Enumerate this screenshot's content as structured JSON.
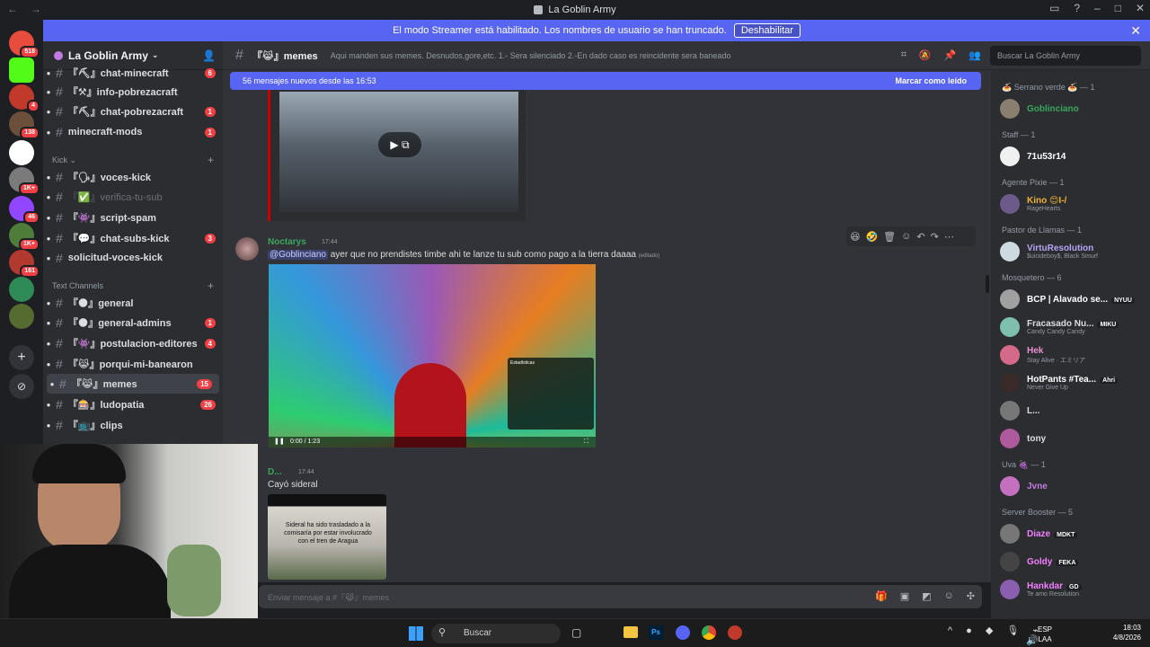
{
  "window": {
    "title": "La Goblin Army"
  },
  "banner": {
    "text": "El modo Streamer está habilitado. Los nombres de usuario se han truncado.",
    "button": "Deshabilitar"
  },
  "servers": [
    {
      "badge": "518",
      "color": "#e74c3c"
    },
    {
      "badge": "",
      "color": "#53fc18"
    },
    {
      "badge": "4",
      "color": "#c0392b"
    },
    {
      "badge": "138",
      "color": "#6b4f3a"
    },
    {
      "badge": "",
      "color": "#ffffff"
    },
    {
      "badge": "1K+",
      "color": "#7a7a7a"
    },
    {
      "badge": "46",
      "color": "#9146ff"
    },
    {
      "badge": "1K+",
      "color": "#4e7d3a"
    },
    {
      "badge": "161",
      "color": "#b03a2e"
    },
    {
      "badge": "",
      "color": "#2e8b57"
    },
    {
      "badge": "",
      "color": "#556b2f"
    }
  ],
  "guild": {
    "name": "La Goblin Army"
  },
  "channels_top": [
    {
      "label": "『⛏』chat-minecraft",
      "badge": "6",
      "muted": false
    },
    {
      "label": "『⚒』info-pobrezacraft",
      "badge": "",
      "muted": false
    },
    {
      "label": "『⛏』chat-pobrezacraft",
      "badge": "1",
      "muted": false
    },
    {
      "label": "minecraft-mods",
      "badge": "1",
      "muted": false
    }
  ],
  "cat_kick": "Kick",
  "channels_kick": [
    {
      "label": "『🗣』voces-kick",
      "badge": "",
      "muted": false
    },
    {
      "label": "『✅』verifica-tu-sub",
      "badge": "",
      "muted": true
    },
    {
      "label": "『👾』script-spam",
      "badge": "",
      "muted": false
    },
    {
      "label": "『💬』chat-subs-kick",
      "badge": "3",
      "muted": false
    },
    {
      "label": "solicitud-voces-kick",
      "badge": "",
      "muted": false
    }
  ],
  "cat_text": "Text Channels",
  "channels_text": [
    {
      "label": "『🌑』general",
      "badge": "",
      "muted": false
    },
    {
      "label": "『🌑』general-admins",
      "badge": "1",
      "muted": false
    },
    {
      "label": "『👾』postulacion-editores",
      "badge": "4",
      "muted": false
    },
    {
      "label": "『😹』porqui-mi-banearon",
      "badge": "",
      "muted": false
    },
    {
      "label": "『😹』memes",
      "badge": "15",
      "muted": false,
      "active": true
    },
    {
      "label": "『🎰』ludopatia",
      "badge": "26",
      "muted": false
    },
    {
      "label": "『📺』clips",
      "badge": "",
      "muted": false
    }
  ],
  "header": {
    "channel": "『😹』memes",
    "topic": "Aqui manden sus memes. Desnudos,gore,etc. 1.- Sera silenciado 2.-En dado caso es reincidente sera baneado",
    "search_placeholder": "Buscar La Goblin Army"
  },
  "newbar": {
    "text": "56 mensajes nuevos desde las 16:53",
    "mark": "Marcar como leído"
  },
  "messages": [
    {
      "user": "Noctarys",
      "time": "17:44",
      "mention": "@Goblinciano",
      "text": " ayer que no prendistes timbe ahi te lanze tu sub como pago a la tierra daaaa",
      "edited": "(editado)",
      "video_time": "0:00 / 1:23",
      "stats_label": "Estadísticas"
    },
    {
      "user": "D...",
      "time": "17:44",
      "text": "Cayó sideral",
      "image_caption": "Sideral ha sido trasladado a la comisaría por estar involucrado con el tren de Aragua"
    }
  ],
  "composer": {
    "placeholder": "Enviar mensaje a #『😹』memes"
  },
  "members": [
    {
      "role": "🍝 Serrano verde 🍝 — 1",
      "items": [
        {
          "name": "Goblinciano",
          "status": "",
          "color": "#3ba55c",
          "tag": ""
        }
      ]
    },
    {
      "role": "Staff — 1",
      "items": [
        {
          "name": "71u53r14",
          "status": "",
          "color": "#ffffff",
          "tag": ""
        }
      ]
    },
    {
      "role": "Agente Pixie — 1",
      "items": [
        {
          "name": "Kino 😊I-/",
          "status": "RageHearts",
          "color": "#f0b232",
          "tag": ""
        }
      ]
    },
    {
      "role": "Pastor de Llamas — 1",
      "items": [
        {
          "name": "VirtuResolution",
          "status": "$uicideboy$, Black Smurf",
          "color": "#b9a5f5",
          "tag": ""
        }
      ]
    },
    {
      "role": "Mosquetero — 6",
      "items": [
        {
          "name": "BCP | Alavado se...",
          "status": "",
          "color": "#ffffff",
          "tag": "NYUU"
        },
        {
          "name": "Fracasado Nu...",
          "status": "Candy Candy Candy",
          "color": "#dbdee1",
          "tag": "MIKU"
        },
        {
          "name": "Hek",
          "status": "Stay Alive · エミリア",
          "color": "#e991d1",
          "tag": ""
        },
        {
          "name": "HotPants #Tea...",
          "status": "Never Give Up",
          "color": "#ffffff",
          "tag": "Ahri"
        },
        {
          "name": "L...",
          "status": "",
          "color": "#dbdee1",
          "tag": ""
        },
        {
          "name": "tony",
          "status": "",
          "color": "#dbdee1",
          "tag": ""
        }
      ]
    },
    {
      "role": "Uva 🍇 — 1",
      "items": [
        {
          "name": "Jvne",
          "status": "",
          "color": "#c27be0",
          "tag": ""
        }
      ]
    },
    {
      "role": "Server Booster — 5",
      "items": [
        {
          "name": "Diaze",
          "status": "",
          "color": "#f47fff",
          "tag": "MDKT"
        },
        {
          "name": "Goldy",
          "status": "",
          "color": "#f47fff",
          "tag": "FEKA"
        },
        {
          "name": "Hankdar",
          "status": "Te amo Resolution",
          "color": "#f47fff",
          "tag": "GD"
        }
      ]
    }
  ],
  "taskbar": {
    "search": "Buscar",
    "lang": "ESP",
    "region": "LAA",
    "time": "18:03",
    "date": "4/8/2026"
  }
}
